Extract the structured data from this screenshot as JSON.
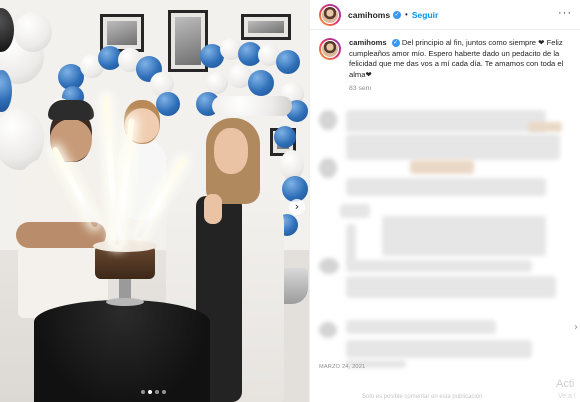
{
  "post": {
    "username": "camihoms",
    "verified_mark": "✓",
    "separator": "•",
    "follow_label": "Seguir",
    "more_label": "···",
    "caption_text": "Del principio al fin, juntos como siempre ❤ Feliz cumpleaños amor mío. Espero haberte dado un pedacito de la felicidad que me das vos a mí cada día. Te amamos con toda el alma❤",
    "caption_age": "83 sem",
    "date": "MARZO 24, 2021",
    "footer_hint": "Solo es posible comentar en esta publicación",
    "carousel_next": "›",
    "carousel_dots": 4,
    "carousel_active": 1
  },
  "overlay": {
    "activate_title": "Acti",
    "activate_sub": "Ve a l"
  },
  "icons": {
    "avatar": "profile-avatar",
    "verified": "verified-badge-icon",
    "more": "more-options-icon",
    "next": "chevron-right-icon"
  },
  "colors": {
    "accent": "#0095f6",
    "verified": "#3897f0",
    "text": "#262626",
    "muted": "#8e8e8e"
  }
}
